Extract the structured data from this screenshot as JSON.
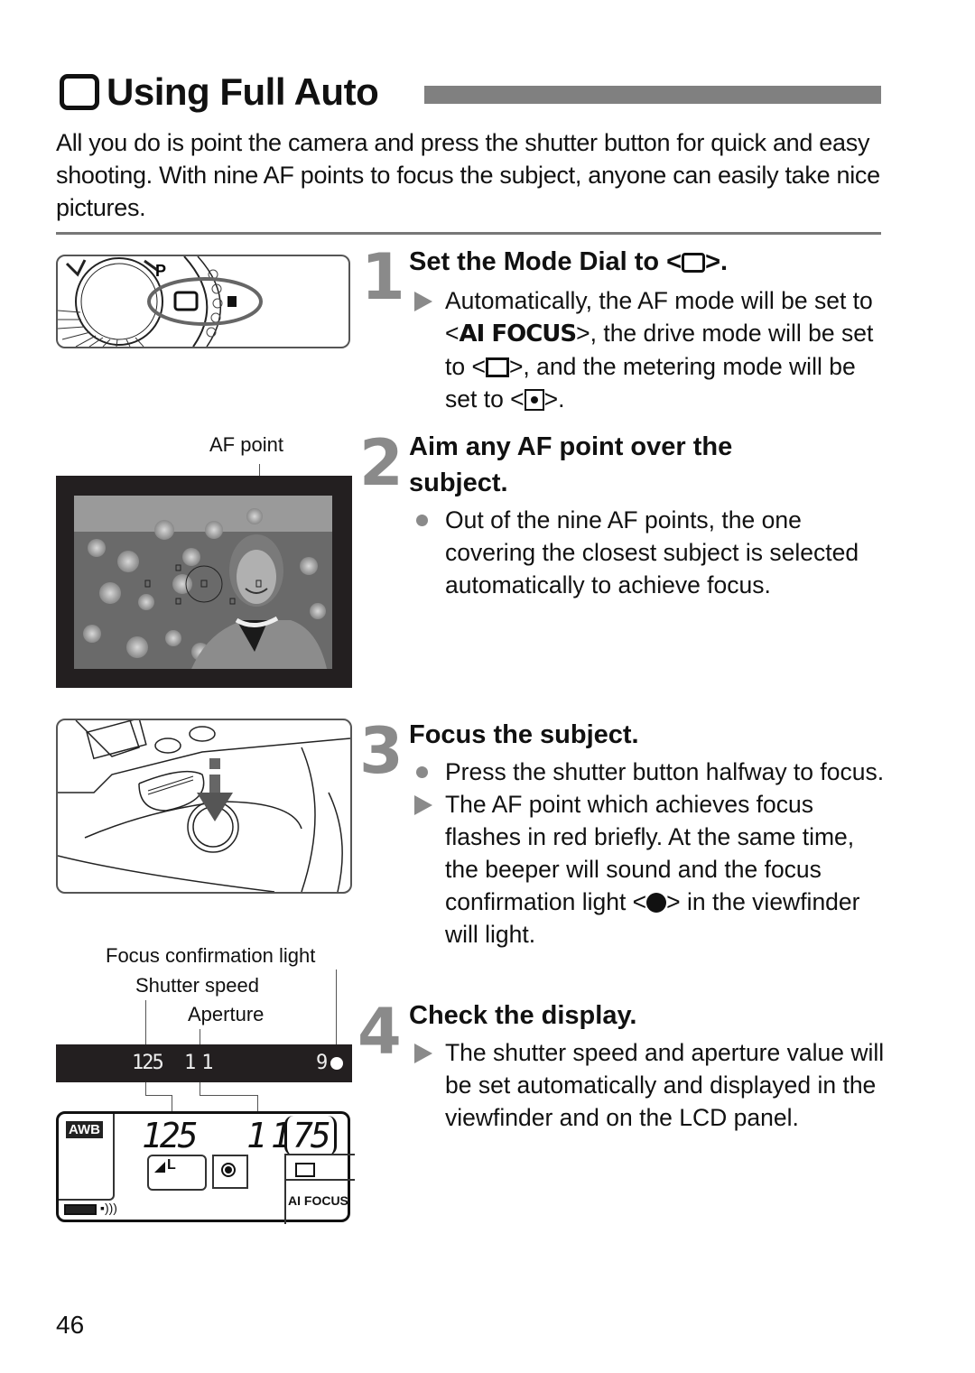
{
  "page": {
    "title": "Using Full Auto",
    "title_icon": "full-auto-mode-icon",
    "intro": "All you do is point the camera and press the shutter button for quick and easy shooting. With nine AF points to focus the subject, anyone can easily take nice pictures.",
    "page_number": "46"
  },
  "steps": [
    {
      "number": "1",
      "title_prefix": "Set the Mode Dial to <",
      "title_suffix": ">.",
      "bullets": [
        {
          "type": "result",
          "parts": [
            "Automatically, the AF mode will be set to <",
            "AI FOCUS",
            ">, the drive mode will be set to <",
            ">, and the metering mode will be set to <",
            ">."
          ]
        }
      ]
    },
    {
      "number": "2",
      "title": "Aim any AF point over the subject.",
      "bullets": [
        {
          "type": "action",
          "text": "Out of the nine AF points, the one covering the closest subject is selected automatically to achieve focus."
        }
      ]
    },
    {
      "number": "3",
      "title": "Focus the subject.",
      "bullets": [
        {
          "type": "action",
          "text": "Press the shutter button halfway to focus."
        },
        {
          "type": "result",
          "parts": [
            "The AF point which achieves focus flashes in red briefly. At the same time, the beeper will sound and the focus confirmation light <",
            "> in the viewfinder will light."
          ]
        }
      ]
    },
    {
      "number": "4",
      "title": "Check the display.",
      "bullets": [
        {
          "type": "result",
          "text": "The shutter speed and aperture value will be set automatically and displayed in the viewfinder and on the LCD panel."
        }
      ]
    }
  ],
  "figures": {
    "mode_dial": {
      "label": "mode-dial-illustration",
      "dial_letter": "P"
    },
    "viewfinder_photo": {
      "caption": "AF point"
    },
    "shutter_press": {
      "label": "shutter-button-illustration"
    },
    "display": {
      "captions": {
        "focus_light": "Focus confirmation light",
        "shutter_speed": "Shutter speed",
        "aperture": "Aperture"
      },
      "viewfinder": {
        "shutter": "125",
        "aperture": "11",
        "burst": "9"
      },
      "lcd": {
        "wb": "AWB",
        "shutter": "125",
        "aperture": "11",
        "shots": "75",
        "quality": "L",
        "af_mode": "AI FOCUS"
      }
    }
  }
}
